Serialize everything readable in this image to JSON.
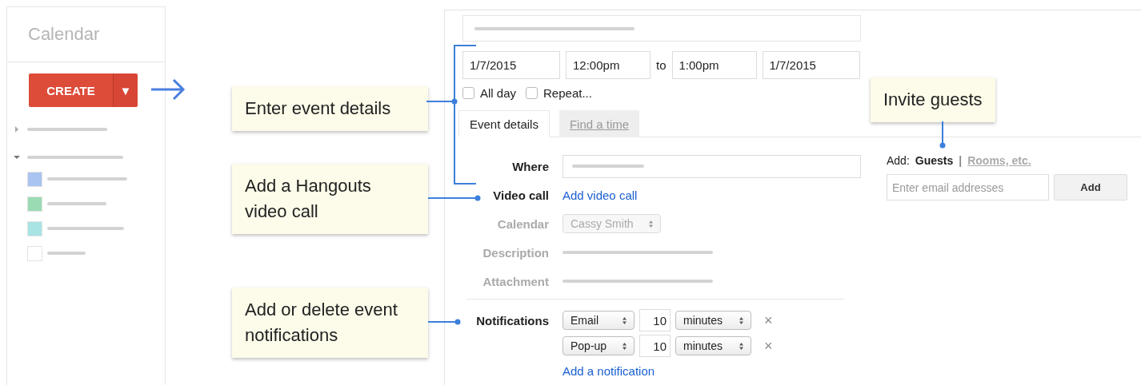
{
  "sidebar": {
    "title": "Calendar",
    "create_button": {
      "label": "CREATE",
      "dropdown": "▼"
    },
    "sections": [
      {
        "expanded": false
      },
      {
        "expanded": true,
        "calendars": [
          {
            "color": "#a9c4f0"
          },
          {
            "color": "#9adbb4"
          },
          {
            "color": "#a8e4e4"
          },
          {
            "color": "#ffffff"
          }
        ]
      }
    ]
  },
  "event_form": {
    "dates": {
      "start_date": "1/7/2015",
      "start_time": "12:00pm",
      "separator": "to",
      "end_time": "1:00pm",
      "end_date": "1/7/2015"
    },
    "options": [
      {
        "label": "All day",
        "checked": false
      },
      {
        "label": "Repeat...",
        "checked": false
      }
    ],
    "tabs": [
      {
        "label": "Event details",
        "selected": true
      },
      {
        "label": "Find a time",
        "selected": false
      }
    ],
    "fields": [
      {
        "kind": "input",
        "label": "Where",
        "emphasized": true
      },
      {
        "kind": "link",
        "label": "Video call",
        "value": "Add video call",
        "emphasized": true
      },
      {
        "kind": "select",
        "label": "Calendar",
        "value": "Cassy Smith",
        "disabled": true,
        "emphasized": false
      },
      {
        "kind": "line",
        "label": "Description",
        "emphasized": false
      },
      {
        "kind": "line",
        "label": "Attachment",
        "emphasized": false
      }
    ],
    "notifications": {
      "label": "Notifications",
      "rows": [
        {
          "method": "Email",
          "amount": "10",
          "unit": "minutes",
          "remove": "×"
        },
        {
          "method": "Pop-up",
          "amount": "10",
          "unit": "minutes",
          "remove": "×"
        }
      ],
      "add_link": "Add a notification"
    }
  },
  "guests": {
    "label": "Add:",
    "separator": "|",
    "tabs": [
      {
        "label": "Guests",
        "selected": true
      },
      {
        "label": "Rooms, etc.",
        "selected": false
      }
    ],
    "input": {
      "placeholder": "Enter email addresses"
    },
    "button": "Add"
  },
  "callouts": [
    {
      "text": "Enter event details"
    },
    {
      "text": "Add a Hangouts video call"
    },
    {
      "text": "Add or delete event notifications"
    },
    {
      "text": "Invite guests"
    }
  ]
}
